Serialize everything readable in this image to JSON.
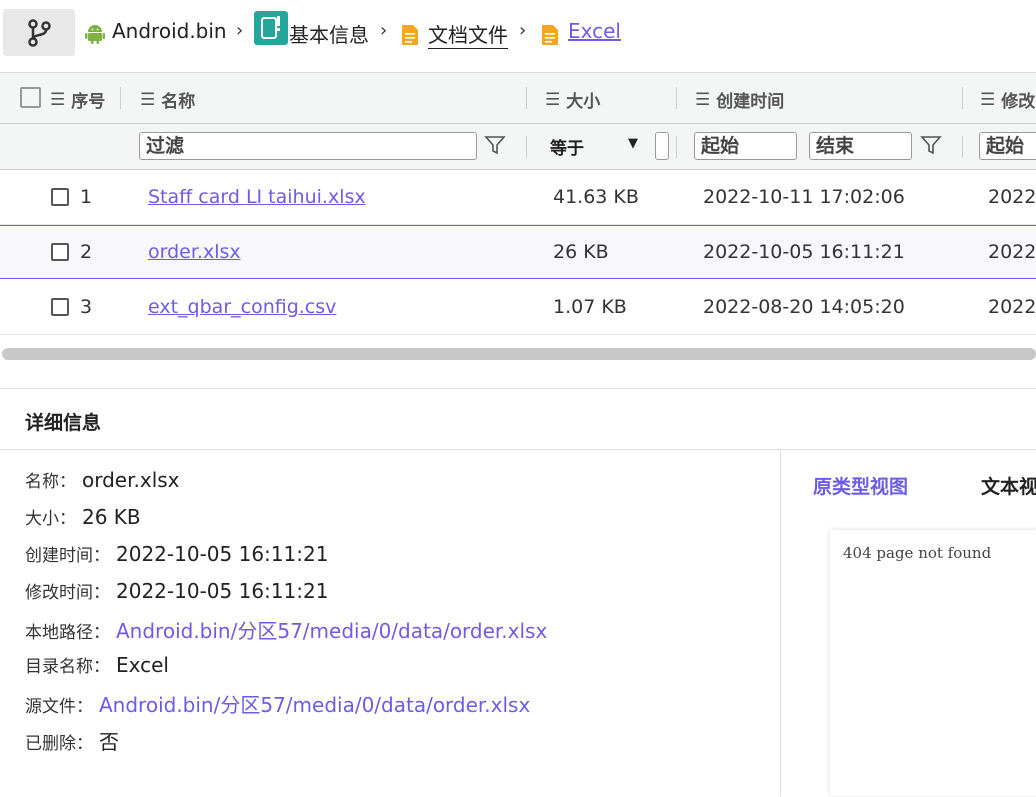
{
  "breadcrumb": {
    "items": [
      {
        "label": "Android.bin",
        "icon": "android-icon"
      },
      {
        "label": "基本信息",
        "icon": "info-icon"
      },
      {
        "label": "文档文件",
        "icon": "document-icon"
      },
      {
        "label": "Excel",
        "icon": "document-icon"
      }
    ],
    "separator": "›"
  },
  "table": {
    "columns": [
      "序号",
      "名称",
      "大小",
      "创建时间",
      "修改"
    ],
    "filter": {
      "name_placeholder": "过滤",
      "size_operator": "等于",
      "created_start": "起始",
      "created_end": "结束",
      "modified_start": "起始"
    },
    "rows": [
      {
        "index": "1",
        "name": "Staff card LI taihui.xlsx",
        "size": "41.63 KB",
        "created": "2022-10-11 17:02:06",
        "modified": "2022-"
      },
      {
        "index": "2",
        "name": "order.xlsx",
        "size": "26 KB",
        "created": "2022-10-05 16:11:21",
        "modified": "2022-"
      },
      {
        "index": "3",
        "name": "ext_qbar_config.csv",
        "size": "1.07 KB",
        "created": "2022-08-20 14:05:20",
        "modified": "2022-"
      }
    ]
  },
  "details": {
    "title": "详细信息",
    "fields": [
      {
        "key": "名称：",
        "value": "order.xlsx",
        "link": false
      },
      {
        "key": "大小：",
        "value": "26 KB",
        "link": false
      },
      {
        "key": "创建时间：",
        "value": "2022-10-05 16:11:21",
        "link": false
      },
      {
        "key": "修改时间：",
        "value": "2022-10-05 16:11:21",
        "link": false
      },
      {
        "key": "本地路径：",
        "value": "Android.bin/分区57/media/0/data/order.xlsx",
        "link": true
      },
      {
        "key": "目录名称：",
        "value": "Excel",
        "link": false
      },
      {
        "key": "源文件：",
        "value": "Android.bin/分区57/media/0/data/order.xlsx",
        "link": true
      },
      {
        "key": "已删除：",
        "value": "否",
        "link": false
      }
    ],
    "tabs": [
      {
        "label": "原类型视图",
        "active": true
      },
      {
        "label": "文本视",
        "active": false
      }
    ],
    "preview_text": "404 page not found"
  },
  "colors": {
    "accent": "#6c5ce7",
    "android_green": "#7cb342",
    "doc_orange": "#f5a623",
    "info_teal": "#26a69a"
  }
}
